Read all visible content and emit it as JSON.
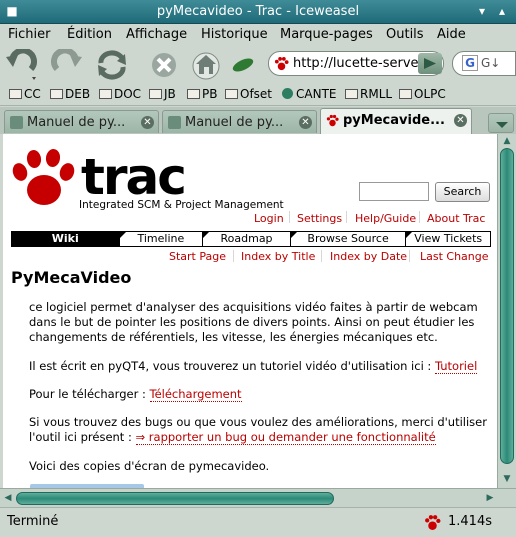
{
  "window": {
    "title": "pyMecavideo - Trac - Iceweasel"
  },
  "menu": [
    {
      "label": "Fichier"
    },
    {
      "label": "Édition"
    },
    {
      "label": "Affichage"
    },
    {
      "label": "Historique"
    },
    {
      "label": "Marque-pages"
    },
    {
      "label": "Outils"
    },
    {
      "label": "Aide"
    }
  ],
  "toolbar": {
    "url": "http://lucette-serve",
    "search_value": "G↓"
  },
  "bookmarks": [
    {
      "label": "CC",
      "icon": "folder-icon"
    },
    {
      "label": "DEB",
      "icon": "folder-icon"
    },
    {
      "label": "DOC",
      "icon": "folder-icon"
    },
    {
      "label": "JB",
      "icon": "folder-icon"
    },
    {
      "label": "PB",
      "icon": "folder-icon"
    },
    {
      "label": "Ofset",
      "icon": "folder-icon"
    },
    {
      "label": "CANTE",
      "icon": "globe-icon"
    },
    {
      "label": "RMLL",
      "icon": "folder-icon"
    },
    {
      "label": "OLPC",
      "icon": "folder-icon"
    }
  ],
  "tabs": [
    {
      "label": "Manuel de py..."
    },
    {
      "label": "Manuel de py..."
    },
    {
      "label": "pyMecavide..."
    }
  ],
  "page": {
    "logo_word": "trac",
    "logo_sub": "Integrated SCM & Project Management",
    "search_button": "Search",
    "metanav": [
      "Login",
      "Settings",
      "Help/Guide",
      "About Trac"
    ],
    "mainnav": [
      "Wiki",
      "Timeline",
      "Roadmap",
      "Browse Source",
      "View Tickets"
    ],
    "ctxtnav": [
      "Start Page",
      "Index by Title",
      "Index by Date",
      "Last Change"
    ],
    "heading": "PyMecaVideo",
    "p1": "ce logiciel permet d'analyser des acquisitions vidéo faites à partir de webcam dans le but de pointer les positions de divers points. Ainsi on peut étudier les changements de référentiels, les vitesse, les énergies mécaniques etc.",
    "p2_text": "Il est écrit en pyQT4, vous trouverez un tutoriel vidéo d'utilisation ici : ",
    "p2_link": "Tutoriel",
    "p3_text": "Pour le télécharger : ",
    "p3_link": "Téléchargement",
    "p4_text": "Si vous trouvez des bugs ou que vous voulez des améliorations, merci d'utiliser l'outil ici présent : ",
    "p4_link": "⇒ rapporter un bug ou demander une fonctionnalité",
    "p5": "Voici des copies d'écran de pymecavideo."
  },
  "status": {
    "text": "Terminé",
    "time": "1.414s"
  },
  "colors": {
    "link": "#bb0000",
    "titlebar": "#2f7d8a",
    "scroll": "#2c8a78"
  }
}
